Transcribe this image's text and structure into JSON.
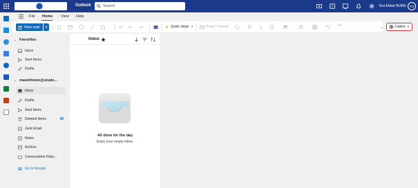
{
  "topbar": {
    "app_title": "Outlook",
    "search_placeholder": "Search",
    "user_name": "Test EMail HUMG",
    "avatar_initials": "TH",
    "icons": [
      "waffle-icon",
      "meet-now-icon",
      "teams-chat-icon",
      "whiteboard-icon",
      "bell-icon",
      "settings-icon"
    ]
  },
  "rail": {
    "apps": [
      "mail-icon",
      "calendar-icon",
      "people-icon",
      "todo-icon",
      "onedrive-icon",
      "word-icon",
      "excel-icon",
      "powerpoint-icon",
      "apps-icon"
    ]
  },
  "tabs": [
    {
      "label": "File"
    },
    {
      "label": "Home"
    },
    {
      "label": "View"
    },
    {
      "label": "Help"
    }
  ],
  "ribbon": {
    "new_mail": "New mail",
    "quick_steps": "Quick steps",
    "read_unread": "Read / Unread",
    "copilot": "Copilot"
  },
  "folders": {
    "favorites_label": "Favorites",
    "favorites": [
      {
        "label": "Inbox",
        "icon": "inbox-icon"
      },
      {
        "label": "Sent Items",
        "icon": "send-icon"
      },
      {
        "label": "Drafts",
        "icon": "pencil-icon"
      }
    ],
    "account_label": "masinhvien@stude...",
    "account_folders": [
      {
        "label": "Inbox",
        "icon": "inbox-icon",
        "count": ""
      },
      {
        "label": "Drafts",
        "icon": "pencil-icon",
        "count": ""
      },
      {
        "label": "Sent Items",
        "icon": "send-icon",
        "count": ""
      },
      {
        "label": "Deleted Items",
        "icon": "trash-icon",
        "count": "40"
      },
      {
        "label": "Junk Email",
        "icon": "junk-icon",
        "count": ""
      },
      {
        "label": "Notes",
        "icon": "note-icon",
        "count": ""
      },
      {
        "label": "Archive",
        "icon": "archive-icon",
        "count": ""
      },
      {
        "label": "Conversation Histo...",
        "icon": "folder-icon",
        "count": ""
      }
    ],
    "go_to_groups": "Go to Groups"
  },
  "message_list": {
    "title": "Inbox",
    "empty_title": "All done for the day",
    "empty_subtitle": "Enjoy your empty inbox."
  },
  "colors": {
    "topbar": "#1b3a8c",
    "accent": "#0f6cbd",
    "copilot_border": "#d13438"
  }
}
